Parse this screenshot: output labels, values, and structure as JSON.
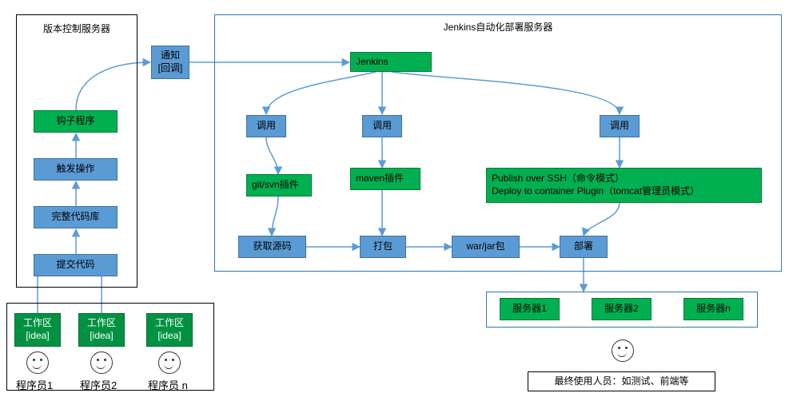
{
  "vcs": {
    "title": "版本控制服务器",
    "hook": "钩子程序",
    "trigger": "触发操作",
    "repo": "完整代码库",
    "commit": "提交代码"
  },
  "notify": "通知\n[回调]",
  "jenkins_server": {
    "title": "Jenkins自动化部署服务器",
    "jenkins": "Jenkins",
    "call1": "调用",
    "call2": "调用",
    "call3": "调用",
    "git_svn_plugin": "git/svn插件",
    "maven_plugin": "maven插件",
    "publish_plugin": "Publish over SSH（命令模式）\nDeploy to container Plugin（tomcat管理员模式）",
    "get_source": "获取源码",
    "package": "打包",
    "war_jar": "war/jar包",
    "deploy": "部署"
  },
  "devs": {
    "workspace": "工作区\n[idea]",
    "dev1": "程序员1",
    "dev2": "程序员2",
    "devn": "程序员 n"
  },
  "servers": {
    "s1": "服务器1",
    "s2": "服务器2",
    "sn": "服务器n"
  },
  "end_user": "最终使用人员：如测试、前端等"
}
